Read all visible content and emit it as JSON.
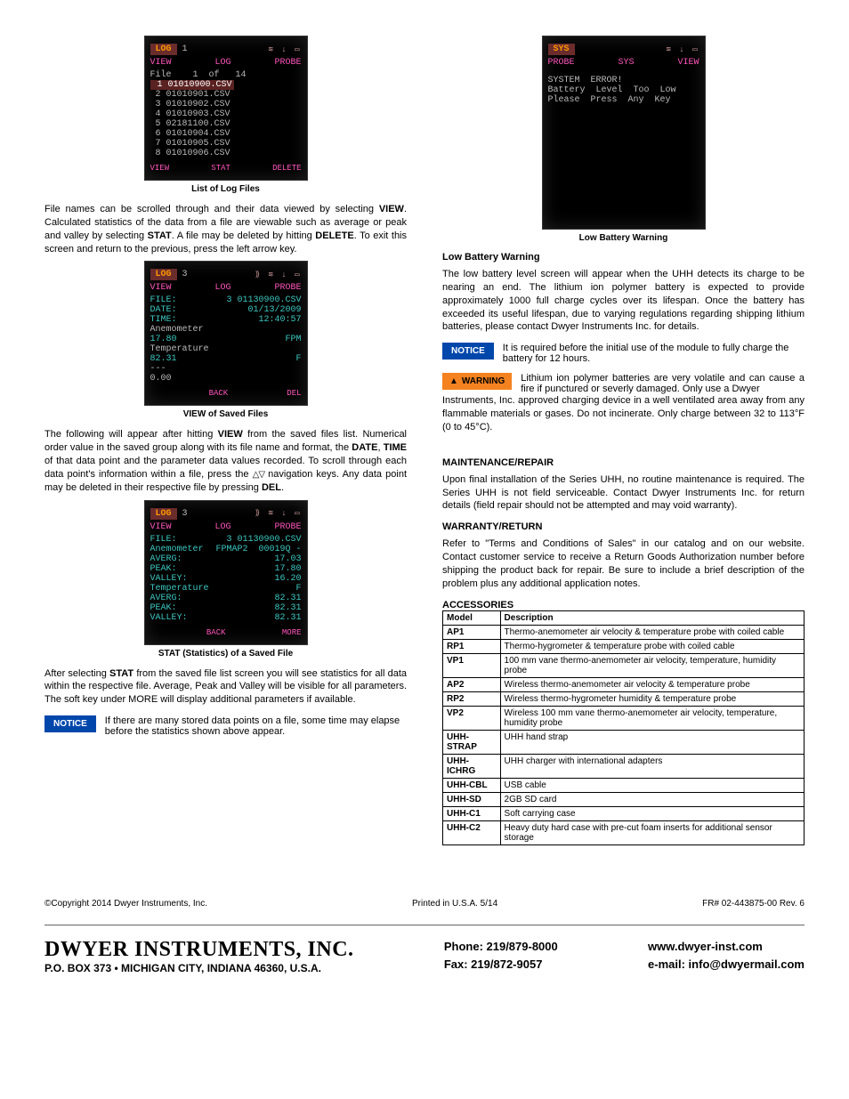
{
  "screen1": {
    "chip": "LOG",
    "num": "1",
    "icons": "   ≋ ↓ ▭",
    "tabs": [
      "VIEW",
      "LOG",
      "PROBE"
    ],
    "fileOf": "File    1  of   14",
    "rows": [
      " 1 01010900.CSV",
      " 2 01010901.CSV",
      " 3 01010902.CSV",
      " 4 01010903.CSV",
      " 5 02181100.CSV",
      " 6 01010904.CSV",
      " 7 01010905.CSV",
      " 8 01010906.CSV"
    ],
    "soft": [
      "VIEW",
      "STAT",
      "DELETE"
    ],
    "caption": "List of Log Files"
  },
  "screen2": {
    "chip": "LOG",
    "num": "3",
    "icons": "⟫ ≋ ↓ ▭",
    "tabs": [
      "VIEW",
      "LOG",
      "PROBE"
    ],
    "lines": [
      {
        "l": "FILE:",
        "r": "3 01130900.CSV",
        "cls": "cyan"
      },
      {
        "l": "DATE:",
        "r": "01/13/2009",
        "cls": "cyan"
      },
      {
        "l": "TIME:",
        "r": "12:40:57",
        "cls": "cyan"
      },
      {
        "l": "Anemometer",
        "r": "",
        "cls": ""
      },
      {
        "l": "17.80",
        "r": "FPM",
        "cls": "cyan"
      },
      {
        "l": "Temperature",
        "r": "",
        "cls": ""
      },
      {
        "l": "82.31",
        "r": "F",
        "cls": "cyan"
      },
      {
        "l": "---",
        "r": "",
        "cls": ""
      },
      {
        "l": "0.00",
        "r": "",
        "cls": ""
      }
    ],
    "soft": [
      "",
      "BACK",
      "DEL"
    ],
    "caption": "VIEW of Saved Files"
  },
  "screen3": {
    "chip": "LOG",
    "num": "3",
    "icons": "⟫ ≋ ↓ ▭",
    "tabs": [
      "VIEW",
      "LOG",
      "PROBE"
    ],
    "lines": [
      {
        "l": "FILE:",
        "r": "3 01130900.CSV",
        "cls": "cyan"
      },
      {
        "l": "",
        "r": "AP2  00019Q -",
        "cls": "cyan"
      },
      {
        "l": "Anemometer",
        "r": "FPM",
        "cls": "cyan"
      },
      {
        "l": "AVERG:",
        "r": "17.03",
        "cls": "cyan"
      },
      {
        "l": "PEAK:",
        "r": "17.80",
        "cls": "cyan"
      },
      {
        "l": "VALLEY:",
        "r": "16.20",
        "cls": "cyan"
      },
      {
        "l": "Temperature",
        "r": "F",
        "cls": "cyan"
      },
      {
        "l": "AVERG:",
        "r": "82.31",
        "cls": "cyan"
      },
      {
        "l": "PEAK:",
        "r": "82.31",
        "cls": "cyan"
      },
      {
        "l": "VALLEY:",
        "r": "82.31",
        "cls": "cyan"
      }
    ],
    "soft": [
      "",
      "BACK",
      "MORE"
    ],
    "caption": "STAT (Statistics) of a Saved File"
  },
  "screen4": {
    "chip": "SYS",
    "icons": "≋ ↓ ▭",
    "tabs": [
      "PROBE",
      "SYS",
      "VIEW"
    ],
    "lines": [
      "SYSTEM  ERROR!",
      "",
      "Battery  Level  Too  Low",
      "",
      "Please  Press  Any  Key"
    ],
    "caption": "Low Battery Warning"
  },
  "paras": {
    "p1": "File names can be scrolled through and their data viewed by selecting ",
    "p1b": ". Calculated statistics of the data from a file are viewable such as average or peak and valley by selecting ",
    "p1c": ". A file may be deleted by hitting ",
    "p1d": ". To exit this screen and return to the previous, press the left arrow key.",
    "p2a": "The following will appear after hitting ",
    "p2b": " from the saved files list.  Numerical order value in the saved group along with its file name and format, the ",
    "p2c": " of that data point and the parameter data values recorded. To scroll through each data point's information within a file, press the  ",
    "p2d": "  navigation keys. Any data point may be deleted in their respective file by pressing ",
    "p3a": "After selecting ",
    "p3b": " from the saved file list screen you will see statistics for all data within the respective file. Average, Peak and Valley will be visible for all parameters. The soft key under MORE will display additional parameters if available.",
    "notice1": "If there are many stored data points on a file, some time may elapse before the statistics shown above appear.",
    "lowBattTitle": "Low Battery Warning",
    "lowBatt": "The low battery level screen will appear when the UHH detects its charge to be nearing an end. The lithium ion polymer battery is expected to provide approximately 1000 full charge cycles over its lifespan. Once the battery has exceeded its useful lifespan, due to varying regulations regarding shipping lithium batteries, please contact Dwyer Instruments Inc. for details.",
    "notice2": "It is required before the initial use of the module to fully charge the battery for 12 hours.",
    "warnLead": "Lithium ion polymer batteries are very volatile and can cause a fire if punctured or severly damaged. Only use a Dwyer",
    "warnRest": "Instruments, Inc. approved charging device in a well ventilated area away from any flammable materials or gases. Do not incinerate. Only charge between 32 to 113°F (0 to 45°C).",
    "maintTitle": "MAINTENANCE/REPAIR",
    "maint": "Upon final installation of the Series UHH, no routine maintenance is required. The Series UHH is not field serviceable. Contact Dwyer Instruments Inc. for return details (field repair should not be attempted and may void warranty).",
    "warrTitle": "WARRANTY/RETURN",
    "warr": "Refer to \"Terms and Conditions of Sales\" in our catalog and on our website. Contact customer service to receive a Return Goods Authorization number before shipping the product back for repair. Be sure to include a brief description of the problem plus any additional application notes.",
    "accTitle": "ACCESSORIES"
  },
  "bold": {
    "VIEW": "VIEW",
    "STAT": "STAT",
    "DELETE": "DELETE",
    "DATE": "DATE",
    "TIME": "TIME",
    "DEL": "DEL",
    "NOTICE": "NOTICE",
    "WARNING": "WARNING"
  },
  "accessories": {
    "head": [
      "Model",
      "Description"
    ],
    "rows": [
      [
        "AP1",
        "Thermo-anemometer air velocity & temperature probe with coiled cable"
      ],
      [
        "RP1",
        "Thermo-hygrometer & temperature probe with coiled cable"
      ],
      [
        "VP1",
        "100 mm vane thermo-anemometer air velocity, temperature, humidity probe"
      ],
      [
        "AP2",
        "Wireless thermo-anemometer air velocity & temperature probe"
      ],
      [
        "RP2",
        "Wireless thermo-hygrometer humidity & temperature probe"
      ],
      [
        "VP2",
        "Wireless 100 mm vane thermo-anemometer air velocity, temperature, humidity probe"
      ],
      [
        "UHH-STRAP",
        "UHH hand strap"
      ],
      [
        "UHH-ICHRG",
        "UHH charger with international adapters"
      ],
      [
        "UHH-CBL",
        "USB cable"
      ],
      [
        "UHH-SD",
        "2GB SD card"
      ],
      [
        "UHH-C1",
        "Soft carrying case"
      ],
      [
        "UHH-C2",
        "Heavy duty hard case with pre-cut foam inserts for additional sensor storage"
      ]
    ]
  },
  "footer": {
    "copyright": "©Copyright 2014 Dwyer Instruments, Inc.",
    "printed": "Printed in U.S.A. 5/14",
    "rev": "FR# 02-443875-00 Rev. 6",
    "company": "DWYER INSTRUMENTS, INC.",
    "addr": "P.O. BOX 373 • MICHIGAN CITY, INDIANA 46360, U.S.A.",
    "phone": "Phone: 219/879-8000",
    "fax": "Fax: 219/872-9057",
    "web": "www.dwyer-inst.com",
    "email": "e-mail: info@dwyermail.com"
  }
}
